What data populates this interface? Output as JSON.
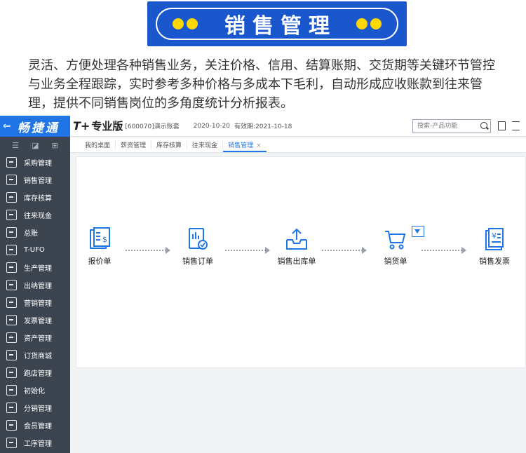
{
  "banner": {
    "title": "销售管理"
  },
  "description": "灵活、方便处理各种销售业务，关注价格、信用、结算账期、交货期等关键环节管控与业务全程跟踪，实时参考多种价格与多成本下毛利，自动形成应收账款到往来管理，提供不同销售岗位的多角度统计分析报表。",
  "app": {
    "brand": "畅捷通",
    "product": "T+",
    "product_sub": "专业版",
    "account": "[600070]演示账套",
    "date": "2020-10-20",
    "valid_until": "有效期:2021-10-18",
    "search_placeholder": "搜索-产品功能",
    "tabs": [
      "我的桌面",
      "薪资管理",
      "库存核算",
      "往来现金",
      "销售管理"
    ],
    "tab_close": "×",
    "sidebar": [
      "采购管理",
      "销售管理",
      "库存核算",
      "往来现金",
      "总账",
      "T-UFO",
      "生产管理",
      "出纳管理",
      "营销管理",
      "发票管理",
      "资产管理",
      "订货商城",
      "跑店管理",
      "初始化",
      "分销管理",
      "会员管理",
      "工序管理"
    ],
    "flow": [
      "报价单",
      "销售订单",
      "销售出库单",
      "销货单",
      "销售发票"
    ]
  },
  "colors": {
    "banner": "#1a56cc",
    "accent": "#1f75e6",
    "dot": "#ffd800",
    "sidebar": "#3c4450"
  }
}
